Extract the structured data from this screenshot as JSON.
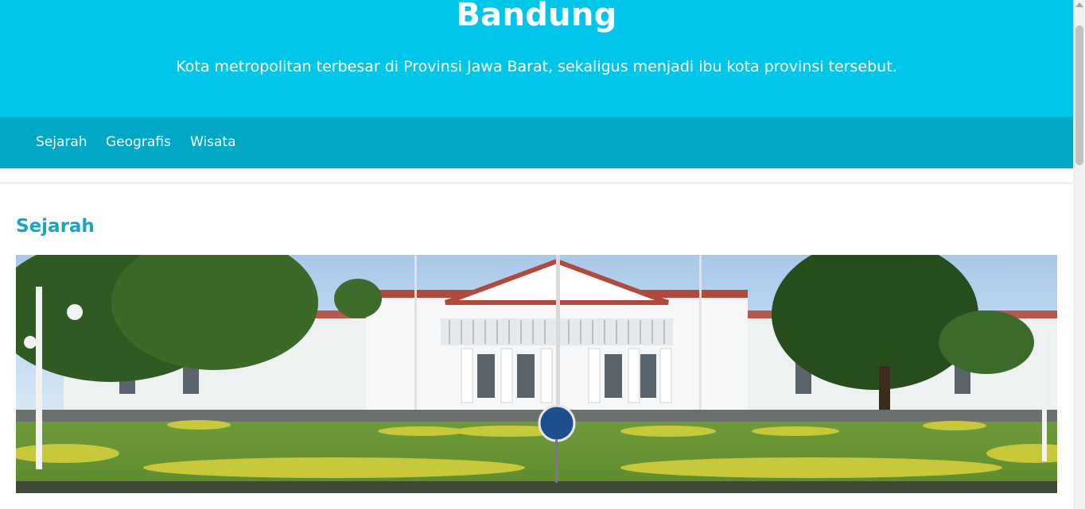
{
  "hero": {
    "title": "Bandung",
    "subtitle": "Kota metropolitan terbesar di Provinsi Jawa Barat, sekaligus menjadi ibu kota provinsi tersebut."
  },
  "nav": {
    "items": [
      {
        "label": "Sejarah"
      },
      {
        "label": "Geografis"
      },
      {
        "label": "Wisata"
      }
    ]
  },
  "section": {
    "title": "Sejarah",
    "image_subject": "Gedung Pakuan, white colonial building with lawn and trees"
  },
  "colors": {
    "hero_bg": "#00c6ea",
    "nav_bg": "#00a8c6",
    "section_title": "#1aa3c7"
  }
}
